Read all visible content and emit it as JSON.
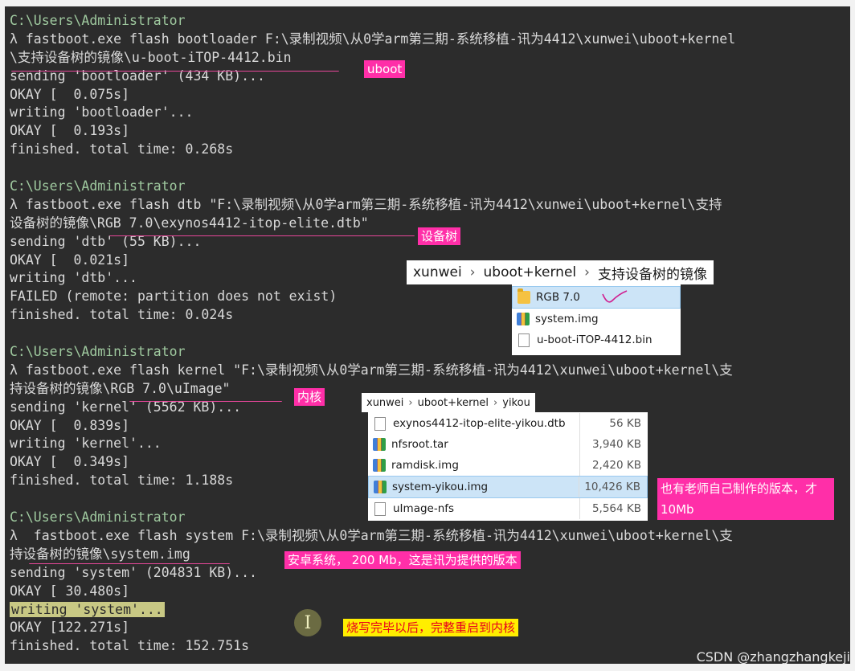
{
  "terminal": {
    "lines": [
      {
        "text": "C:\\Users\\Administrator",
        "kind": "path"
      },
      {
        "text": "λ fastboot.exe flash bootloader F:\\录制视频\\从0学arm第三期-系统移植-讯为4412\\xunwei\\uboot+kernel"
      },
      {
        "text": "\\支持设备树的镜像\\u-boot-iTOP-4412.bin"
      },
      {
        "text": "sending 'bootloader' (434 KB)..."
      },
      {
        "text": "OKAY [  0.075s]"
      },
      {
        "text": "writing 'bootloader'..."
      },
      {
        "text": "OKAY [  0.193s]"
      },
      {
        "text": "finished. total time: 0.268s"
      },
      {
        "text": "",
        "kind": "gap"
      },
      {
        "text": "C:\\Users\\Administrator",
        "kind": "path"
      },
      {
        "text": "λ fastboot.exe flash dtb \"F:\\录制视频\\从0学arm第三期-系统移植-讯为4412\\xunwei\\uboot+kernel\\支持"
      },
      {
        "text": "设备树的镜像\\RGB 7.0\\exynos4412-itop-elite.dtb\""
      },
      {
        "text": "sending 'dtb' (55 KB)..."
      },
      {
        "text": "OKAY [  0.021s]"
      },
      {
        "text": "writing 'dtb'..."
      },
      {
        "text": "FAILED (remote: partition does not exist)"
      },
      {
        "text": "finished. total time: 0.024s"
      },
      {
        "text": "",
        "kind": "gap"
      },
      {
        "text": "C:\\Users\\Administrator",
        "kind": "path"
      },
      {
        "text": "λ fastboot.exe flash kernel \"F:\\录制视频\\从0学arm第三期-系统移植-讯为4412\\xunwei\\uboot+kernel\\支"
      },
      {
        "text": "持设备树的镜像\\RGB 7.0\\uImage\""
      },
      {
        "text": "sending 'kernel' (5562 KB)..."
      },
      {
        "text": "OKAY [  0.839s]"
      },
      {
        "text": "writing 'kernel'..."
      },
      {
        "text": "OKAY [  0.349s]"
      },
      {
        "text": "finished. total time: 1.188s"
      },
      {
        "text": "",
        "kind": "gap"
      },
      {
        "text": "C:\\Users\\Administrator",
        "kind": "path"
      },
      {
        "text": "λ  fastboot.exe flash system F:\\录制视频\\从0学arm第三期-系统移植-讯为4412\\xunwei\\uboot+kernel\\支"
      },
      {
        "text": "持设备树的镜像\\system.img"
      },
      {
        "text": "sending 'system' (204831 KB)..."
      },
      {
        "text": "OKAY [ 30.480s]"
      },
      {
        "text": "writing 'system'...",
        "kind": "highlight"
      },
      {
        "text": "OKAY [122.271s]"
      },
      {
        "text": "finished. total time: 152.751s"
      }
    ]
  },
  "annotations": {
    "uboot": "uboot",
    "dtb": "设备树",
    "kernel": "内核",
    "own_version": "也有老师自己制作的版本，才 10Mb",
    "android": "安卓系统， 200 Mb，这是讯为提供的版本",
    "restart": "烧写完毕以后，完整重启到内核"
  },
  "explorer1": {
    "breadcrumb": [
      "xunwei",
      "uboot+kernel",
      "支持设备树的镜像"
    ],
    "files": [
      {
        "name": "RGB 7.0",
        "icon": "folder-icon",
        "selected": true
      },
      {
        "name": "system.img",
        "icon": "archive-icon"
      },
      {
        "name": "u-boot-iTOP-4412.bin",
        "icon": "file-icon"
      }
    ]
  },
  "explorer2": {
    "breadcrumb": [
      "xunwei",
      "uboot+kernel",
      "yikou"
    ],
    "files": [
      {
        "name": "exynos4412-itop-elite-yikou.dtb",
        "size": "56 KB",
        "icon": "file-icon"
      },
      {
        "name": "nfsroot.tar",
        "size": "3,940 KB",
        "icon": "archive-icon"
      },
      {
        "name": "ramdisk.img",
        "size": "2,420 KB",
        "icon": "archive-icon"
      },
      {
        "name": "system-yikou.img",
        "size": "10,426 KB",
        "icon": "archive-icon",
        "selected": true
      },
      {
        "name": "uImage-nfs",
        "size": "5,564 KB",
        "icon": "file-icon"
      }
    ]
  },
  "separator_glyph": "›",
  "cursor_glyph": "I",
  "watermark": "CSDN @zhangzhangkeji",
  "colors": {
    "terminal_bg": "#2c2c2c",
    "annotation_pink": "#ff2fa8",
    "annotation_yellow": "#ffee00",
    "underline": "#e8479a"
  }
}
